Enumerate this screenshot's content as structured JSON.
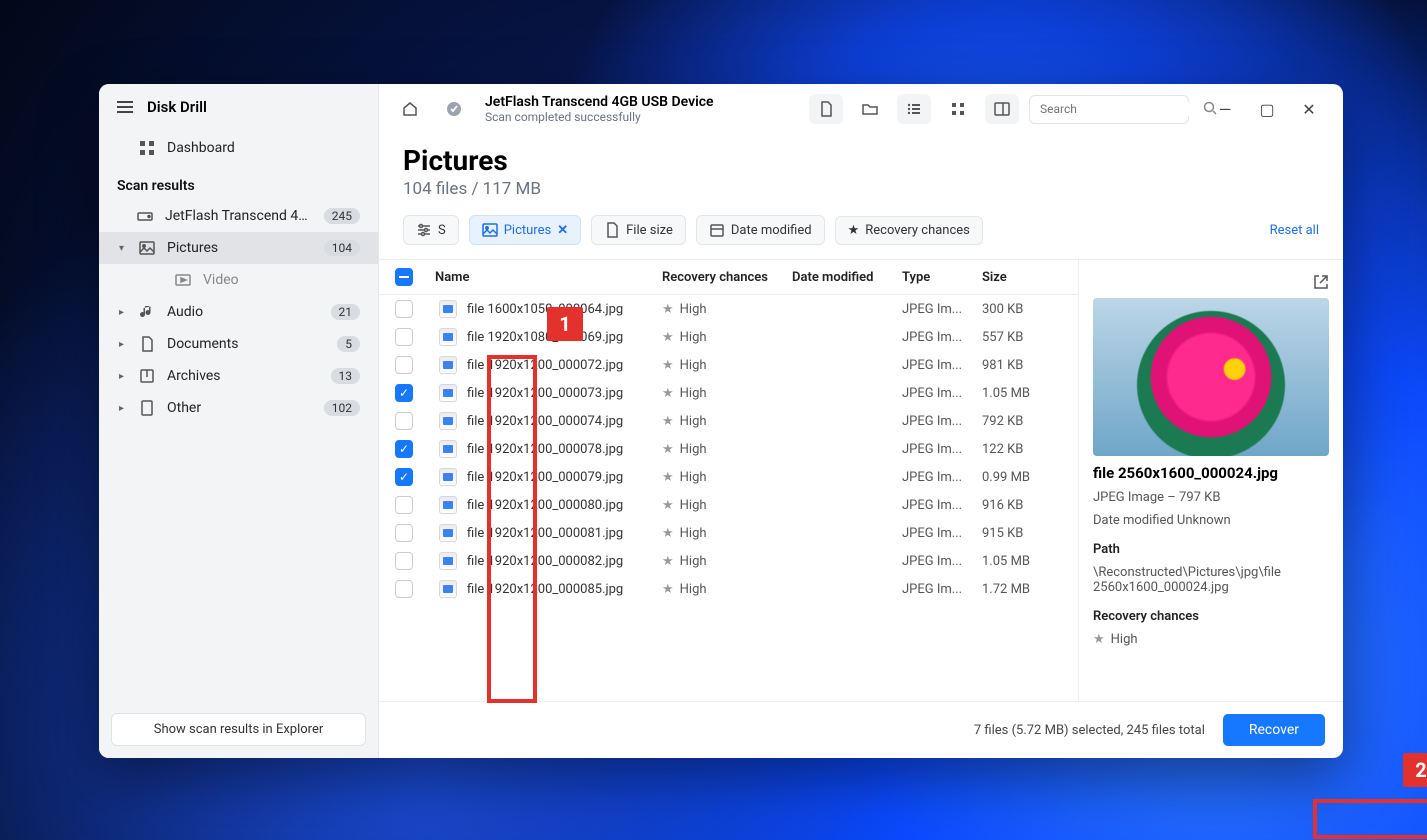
{
  "app_title": "Disk Drill",
  "sidebar": {
    "dashboard": "Dashboard",
    "scan_results_heading": "Scan results",
    "drive": {
      "label": "JetFlash Transcend 4GB...",
      "count": "245"
    },
    "categories": [
      {
        "label": "Pictures",
        "count": "104",
        "expanded": true,
        "selected": true,
        "icon": "image"
      },
      {
        "label": "Video",
        "count": "",
        "icon": "video",
        "child": true
      },
      {
        "label": "Audio",
        "count": "21",
        "icon": "audio"
      },
      {
        "label": "Documents",
        "count": "5",
        "icon": "document"
      },
      {
        "label": "Archives",
        "count": "13",
        "icon": "archive"
      },
      {
        "label": "Other",
        "count": "102",
        "icon": "other"
      }
    ],
    "footer_button": "Show scan results in Explorer"
  },
  "titlebar": {
    "device": "JetFlash Transcend 4GB USB Device",
    "status": "Scan completed successfully",
    "search_placeholder": "Search"
  },
  "content": {
    "heading": "Pictures",
    "subheading": "104 files / 117 MB"
  },
  "filters": {
    "sort_partial": "S",
    "pictures": "Pictures",
    "file_size": "File size",
    "date_modified": "Date modified",
    "recovery_chances": "Recovery chances",
    "reset": "Reset all"
  },
  "table": {
    "headers": {
      "name": "Name",
      "rc": "Recovery chances",
      "date": "Date modified",
      "type": "Type",
      "size": "Size"
    },
    "rows": [
      {
        "checked": false,
        "name": "file 1600x1050_000064.jpg",
        "rc": "High",
        "date": "",
        "type": "JPEG Im...",
        "size": "300 KB"
      },
      {
        "checked": false,
        "name": "file 1920x1080_000069.jpg",
        "rc": "High",
        "date": "",
        "type": "JPEG Im...",
        "size": "557 KB"
      },
      {
        "checked": false,
        "name": "file 1920x1200_000072.jpg",
        "rc": "High",
        "date": "",
        "type": "JPEG Im...",
        "size": "981 KB"
      },
      {
        "checked": true,
        "name": "file 1920x1200_000073.jpg",
        "rc": "High",
        "date": "",
        "type": "JPEG Im...",
        "size": "1.05 MB"
      },
      {
        "checked": false,
        "name": "file 1920x1200_000074.jpg",
        "rc": "High",
        "date": "",
        "type": "JPEG Im...",
        "size": "792 KB"
      },
      {
        "checked": true,
        "name": "file 1920x1200_000078.jpg",
        "rc": "High",
        "date": "",
        "type": "JPEG Im...",
        "size": "122 KB"
      },
      {
        "checked": true,
        "name": "file 1920x1200_000079.jpg",
        "rc": "High",
        "date": "",
        "type": "JPEG Im...",
        "size": "0.99 MB"
      },
      {
        "checked": false,
        "name": "file 1920x1200_000080.jpg",
        "rc": "High",
        "date": "",
        "type": "JPEG Im...",
        "size": "916 KB"
      },
      {
        "checked": false,
        "name": "file 1920x1200_000081.jpg",
        "rc": "High",
        "date": "",
        "type": "JPEG Im...",
        "size": "915 KB"
      },
      {
        "checked": false,
        "name": "file 1920x1200_000082.jpg",
        "rc": "High",
        "date": "",
        "type": "JPEG Im...",
        "size": "1.05 MB"
      },
      {
        "checked": false,
        "name": "file 1920x1200_000085.jpg",
        "rc": "High",
        "date": "",
        "type": "JPEG Im...",
        "size": "1.72 MB"
      }
    ]
  },
  "preview": {
    "filename": "file 2560x1600_000024.jpg",
    "meta": "JPEG Image – 797 KB",
    "date": "Date modified Unknown",
    "path_label": "Path",
    "path": "\\Reconstructed\\Pictures\\jpg\\file 2560x1600_000024.jpg",
    "rc_label": "Recovery chances",
    "rc": "High"
  },
  "footer": {
    "selection": "7 files (5.72 MB) selected, 245 files total",
    "recover": "Recover"
  },
  "annotations": {
    "one": "1",
    "two": "2"
  }
}
